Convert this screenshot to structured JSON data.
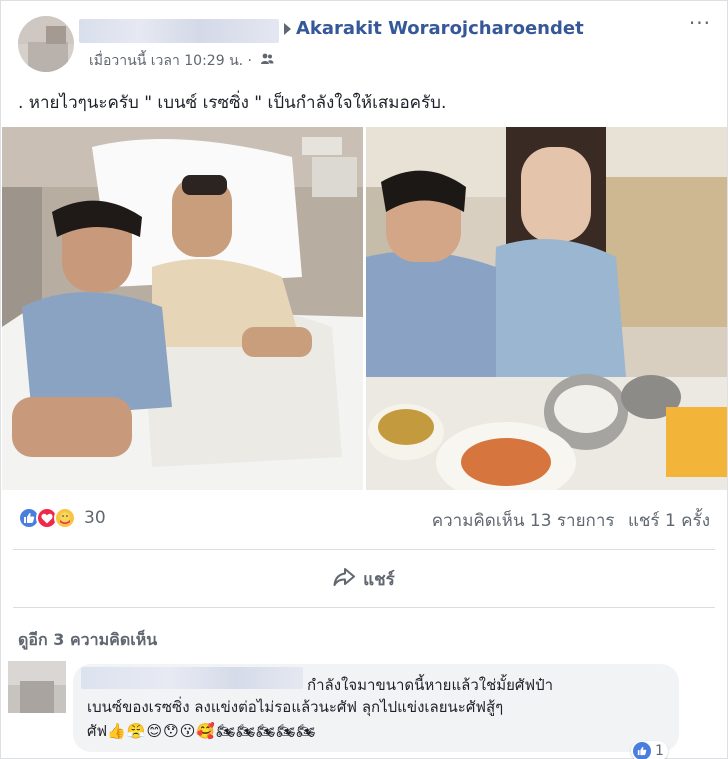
{
  "post": {
    "author": "Akarakit Worarojcharoendet",
    "timestamp": "เมื่อวานนี้ เวลา 10:29 น.",
    "separator": "·",
    "more_icon": "more-dots-icon",
    "text": ". หายไวๆนะครับ \" เบนซ์ เรซซิ่ง \" เป็นกำลังใจให้เสมอครับ."
  },
  "reactions": {
    "count": "30",
    "types": [
      "like",
      "love",
      "care"
    ],
    "comments_label": "ความคิดเห็น 13 รายการ",
    "shares_label": "แชร์ 1 ครั้ง"
  },
  "actions": {
    "share_label": "แชร์"
  },
  "comments": {
    "more_label": "ดูอีก 3 ความคิดเห็น",
    "items": [
      {
        "line1": "กำลังใจมาขนาดนี้หายแล้วใช่มั้ยศัฟป๋า",
        "line2": "เบนซ์ของเรซซิ่ง ลงแข่งต่อไม่รอแล้วนะศัฟ ลุกไปแข่งเลยนะศัฟสู้ๆ",
        "line3_text": "ศัฟ",
        "line3_emoji": "👍😤😊😯😗🥰🏍🏍🏍🏍🏍",
        "likes": "1"
      }
    ]
  },
  "colors": {
    "link": "#365899",
    "muted": "#606770",
    "like_blue": "#4a7ede",
    "love_red": "#f0284a"
  }
}
